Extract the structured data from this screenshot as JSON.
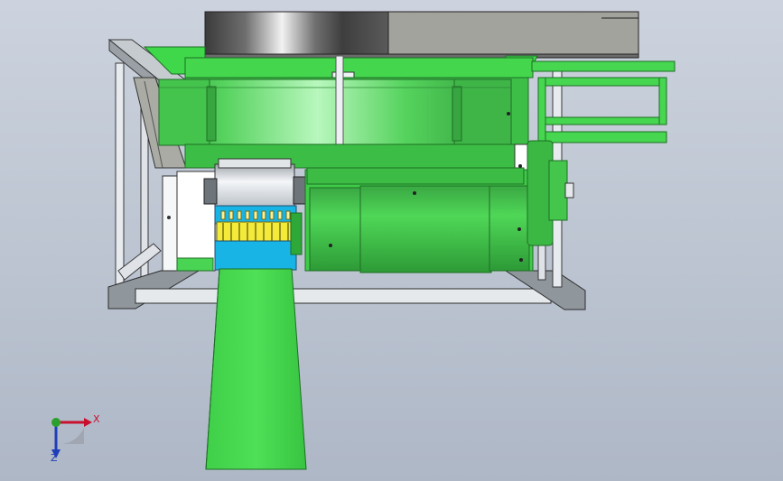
{
  "viewport": {
    "background_top": "#ccd3de",
    "background_bottom": "#aeb7c6"
  },
  "model": {
    "colors": {
      "green": "#3fd84a",
      "green_dark": "#2fa83a",
      "frame_grey": "#d4d8dc",
      "frame_dark": "#8f969c",
      "motor_green": "#46c24e",
      "blue": "#1ab3e8",
      "yellow": "#f3ea3a",
      "hopper_grey": "#a2a29c",
      "belt_green": "#41d44c"
    },
    "parts": [
      "frame",
      "top-plate",
      "hopper-ring",
      "side-bracket",
      "motor",
      "cutter-roller",
      "discharge-chute",
      "outfeed-conveyor"
    ]
  },
  "triad": {
    "x_label": "X",
    "z_label": "Z",
    "x_color": "#c8102e",
    "y_color": "#2ca02c",
    "z_color": "#1f3fb8"
  }
}
